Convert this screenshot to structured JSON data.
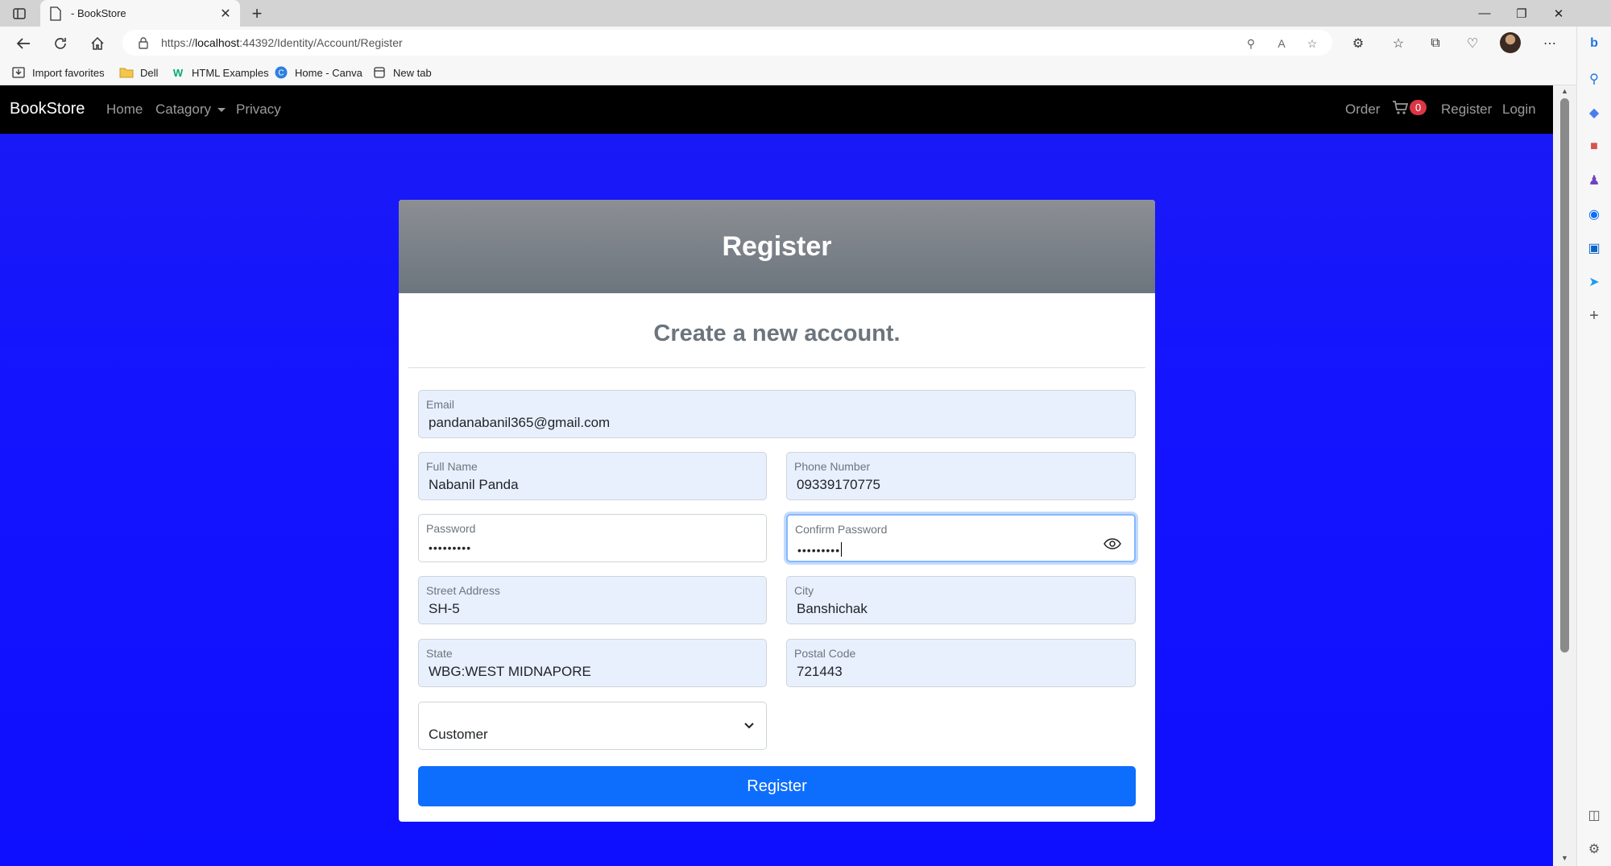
{
  "browser": {
    "tab_title": "- BookStore",
    "new_tab_symbol": "+",
    "url_prefix": "https://",
    "url_host": "localhost",
    "url_rest": ":44392/Identity/Account/Register",
    "favorites": [
      {
        "label": "Import favorites",
        "icon": "import-icon"
      },
      {
        "label": "Dell",
        "icon": "folder-icon"
      },
      {
        "label": "HTML Examples",
        "icon": "w3-icon"
      },
      {
        "label": "Home - Canva",
        "icon": "canva-icon"
      },
      {
        "label": "New tab",
        "icon": "newtab-icon"
      }
    ]
  },
  "site": {
    "brand": "BookStore",
    "nav": {
      "home": "Home",
      "category": "Catagory",
      "privacy": "Privacy",
      "order": "Order",
      "cart_count": "0",
      "register": "Register",
      "login": "Login"
    }
  },
  "form": {
    "header": "Register",
    "subtitle": "Create a new account.",
    "email": {
      "label": "Email",
      "value": "pandanabanil365@gmail.com"
    },
    "full_name": {
      "label": "Full Name",
      "value": "Nabanil Panda"
    },
    "phone": {
      "label": "Phone Number",
      "value": "09339170775"
    },
    "password": {
      "label": "Password",
      "value": "•••••••••"
    },
    "confirm_password": {
      "label": "Confirm Password",
      "value": "•••••••••"
    },
    "street": {
      "label": "Street Address",
      "value": "SH-5"
    },
    "city": {
      "label": "City",
      "value": "Banshichak"
    },
    "state": {
      "label": "State",
      "value": "WBG:WEST MIDNAPORE"
    },
    "postal": {
      "label": "Postal Code",
      "value": "721443"
    },
    "role": {
      "value": "Customer"
    },
    "submit": "Register"
  },
  "colors": {
    "page_bg": "#1414ff",
    "navbar": "#000000",
    "primary": "#0d6efd",
    "badge": "#dc3545",
    "card_header": "#6c757d"
  }
}
